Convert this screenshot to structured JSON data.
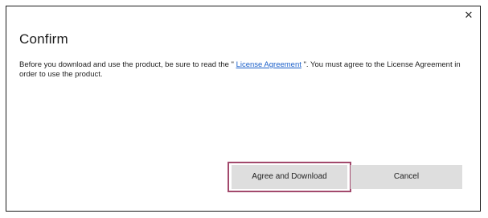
{
  "dialog": {
    "title": "Confirm",
    "close_glyph": "✕",
    "message": {
      "before": " Before you download and use the product, be sure to read the \" ",
      "link": "License Agreement",
      "after": " \". You must agree to the License Agreement in order to use the product."
    },
    "buttons": {
      "agree_label": "Agree and Download",
      "cancel_label": "Cancel"
    }
  },
  "colors": {
    "link": "#1a5fc9",
    "highlight_border": "#a2496c",
    "button_bg": "#dedede"
  },
  "icons": {
    "close": "close-icon"
  }
}
